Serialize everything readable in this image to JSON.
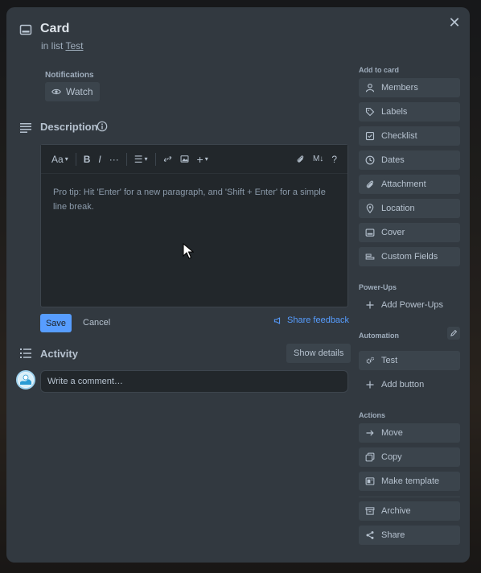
{
  "card": {
    "title": "Card",
    "in_list_prefix": "in list",
    "list_name": "Test"
  },
  "notifications": {
    "label": "Notifications",
    "watch_label": "Watch"
  },
  "description": {
    "title": "Description",
    "placeholder": "Pro tip: Hit 'Enter' for a new paragraph, and 'Shift + Enter' for a simple line break.",
    "toolbar": {
      "text_style": "Aa",
      "bold": "B",
      "italic": "I",
      "more": "···",
      "list": "☰",
      "link": "🔗",
      "image": "▣",
      "insert": "+",
      "attach": "📎",
      "markdown": "M↓",
      "help": "?"
    },
    "save_label": "Save",
    "cancel_label": "Cancel",
    "share_feedback_label": "Share feedback"
  },
  "activity": {
    "title": "Activity",
    "show_details_label": "Show details",
    "comment_placeholder": "Write a comment…"
  },
  "sidebar": {
    "add_to_card_label": "Add to card",
    "add_to_card": [
      {
        "label": "Members",
        "icon": "person-icon"
      },
      {
        "label": "Labels",
        "icon": "tag-icon"
      },
      {
        "label": "Checklist",
        "icon": "checkbox-icon"
      },
      {
        "label": "Dates",
        "icon": "clock-icon"
      },
      {
        "label": "Attachment",
        "icon": "paperclip-icon"
      },
      {
        "label": "Location",
        "icon": "location-pin-icon"
      },
      {
        "label": "Cover",
        "icon": "cover-icon"
      },
      {
        "label": "Custom Fields",
        "icon": "custom-fields-icon"
      }
    ],
    "power_ups_label": "Power-Ups",
    "add_power_ups_label": "Add Power-Ups",
    "automation_label": "Automation",
    "automation_items": [
      {
        "label": "Test",
        "icon": "gears-icon"
      },
      {
        "label": "Add button",
        "icon": "plus-icon"
      }
    ],
    "actions_label": "Actions",
    "actions": [
      {
        "label": "Move",
        "icon": "arrow-right-icon"
      },
      {
        "label": "Copy",
        "icon": "copy-icon"
      },
      {
        "label": "Make template",
        "icon": "template-icon"
      }
    ],
    "archive_label": "Archive",
    "share_label": "Share"
  },
  "colors": {
    "modal_bg": "#323940",
    "button_bg": "#3b444c",
    "accent": "#579dff",
    "text": "#b6c2cf"
  }
}
